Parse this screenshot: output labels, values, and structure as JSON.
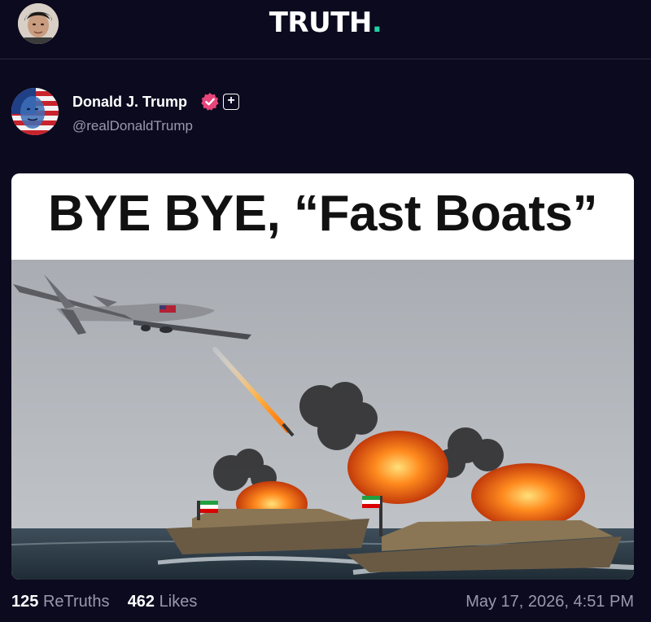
{
  "header": {
    "logo_text": "TRUTH",
    "logo_dot": ".",
    "logo_dot_color": "#25d1a4",
    "current_user_avatar": "user-avatar"
  },
  "post": {
    "author_name": "Donald J. Trump",
    "author_handle": "@realDonaldTrump",
    "verified_icon": "verified-badge-icon",
    "verified_color": "#e8457a",
    "follow_icon": "plus-icon",
    "follow_glyph": "+",
    "media": {
      "headline": "BYE BYE, “Fast Boats”",
      "description_icon": "image-drone-strike-boats"
    },
    "retruths_count": "125",
    "retruths_label": "ReTruths",
    "likes_count": "462",
    "likes_label": "Likes",
    "timestamp": "May 17, 2026, 4:51 PM"
  },
  "colors": {
    "background": "#0c0a1f",
    "muted_text": "#9a98ad"
  }
}
